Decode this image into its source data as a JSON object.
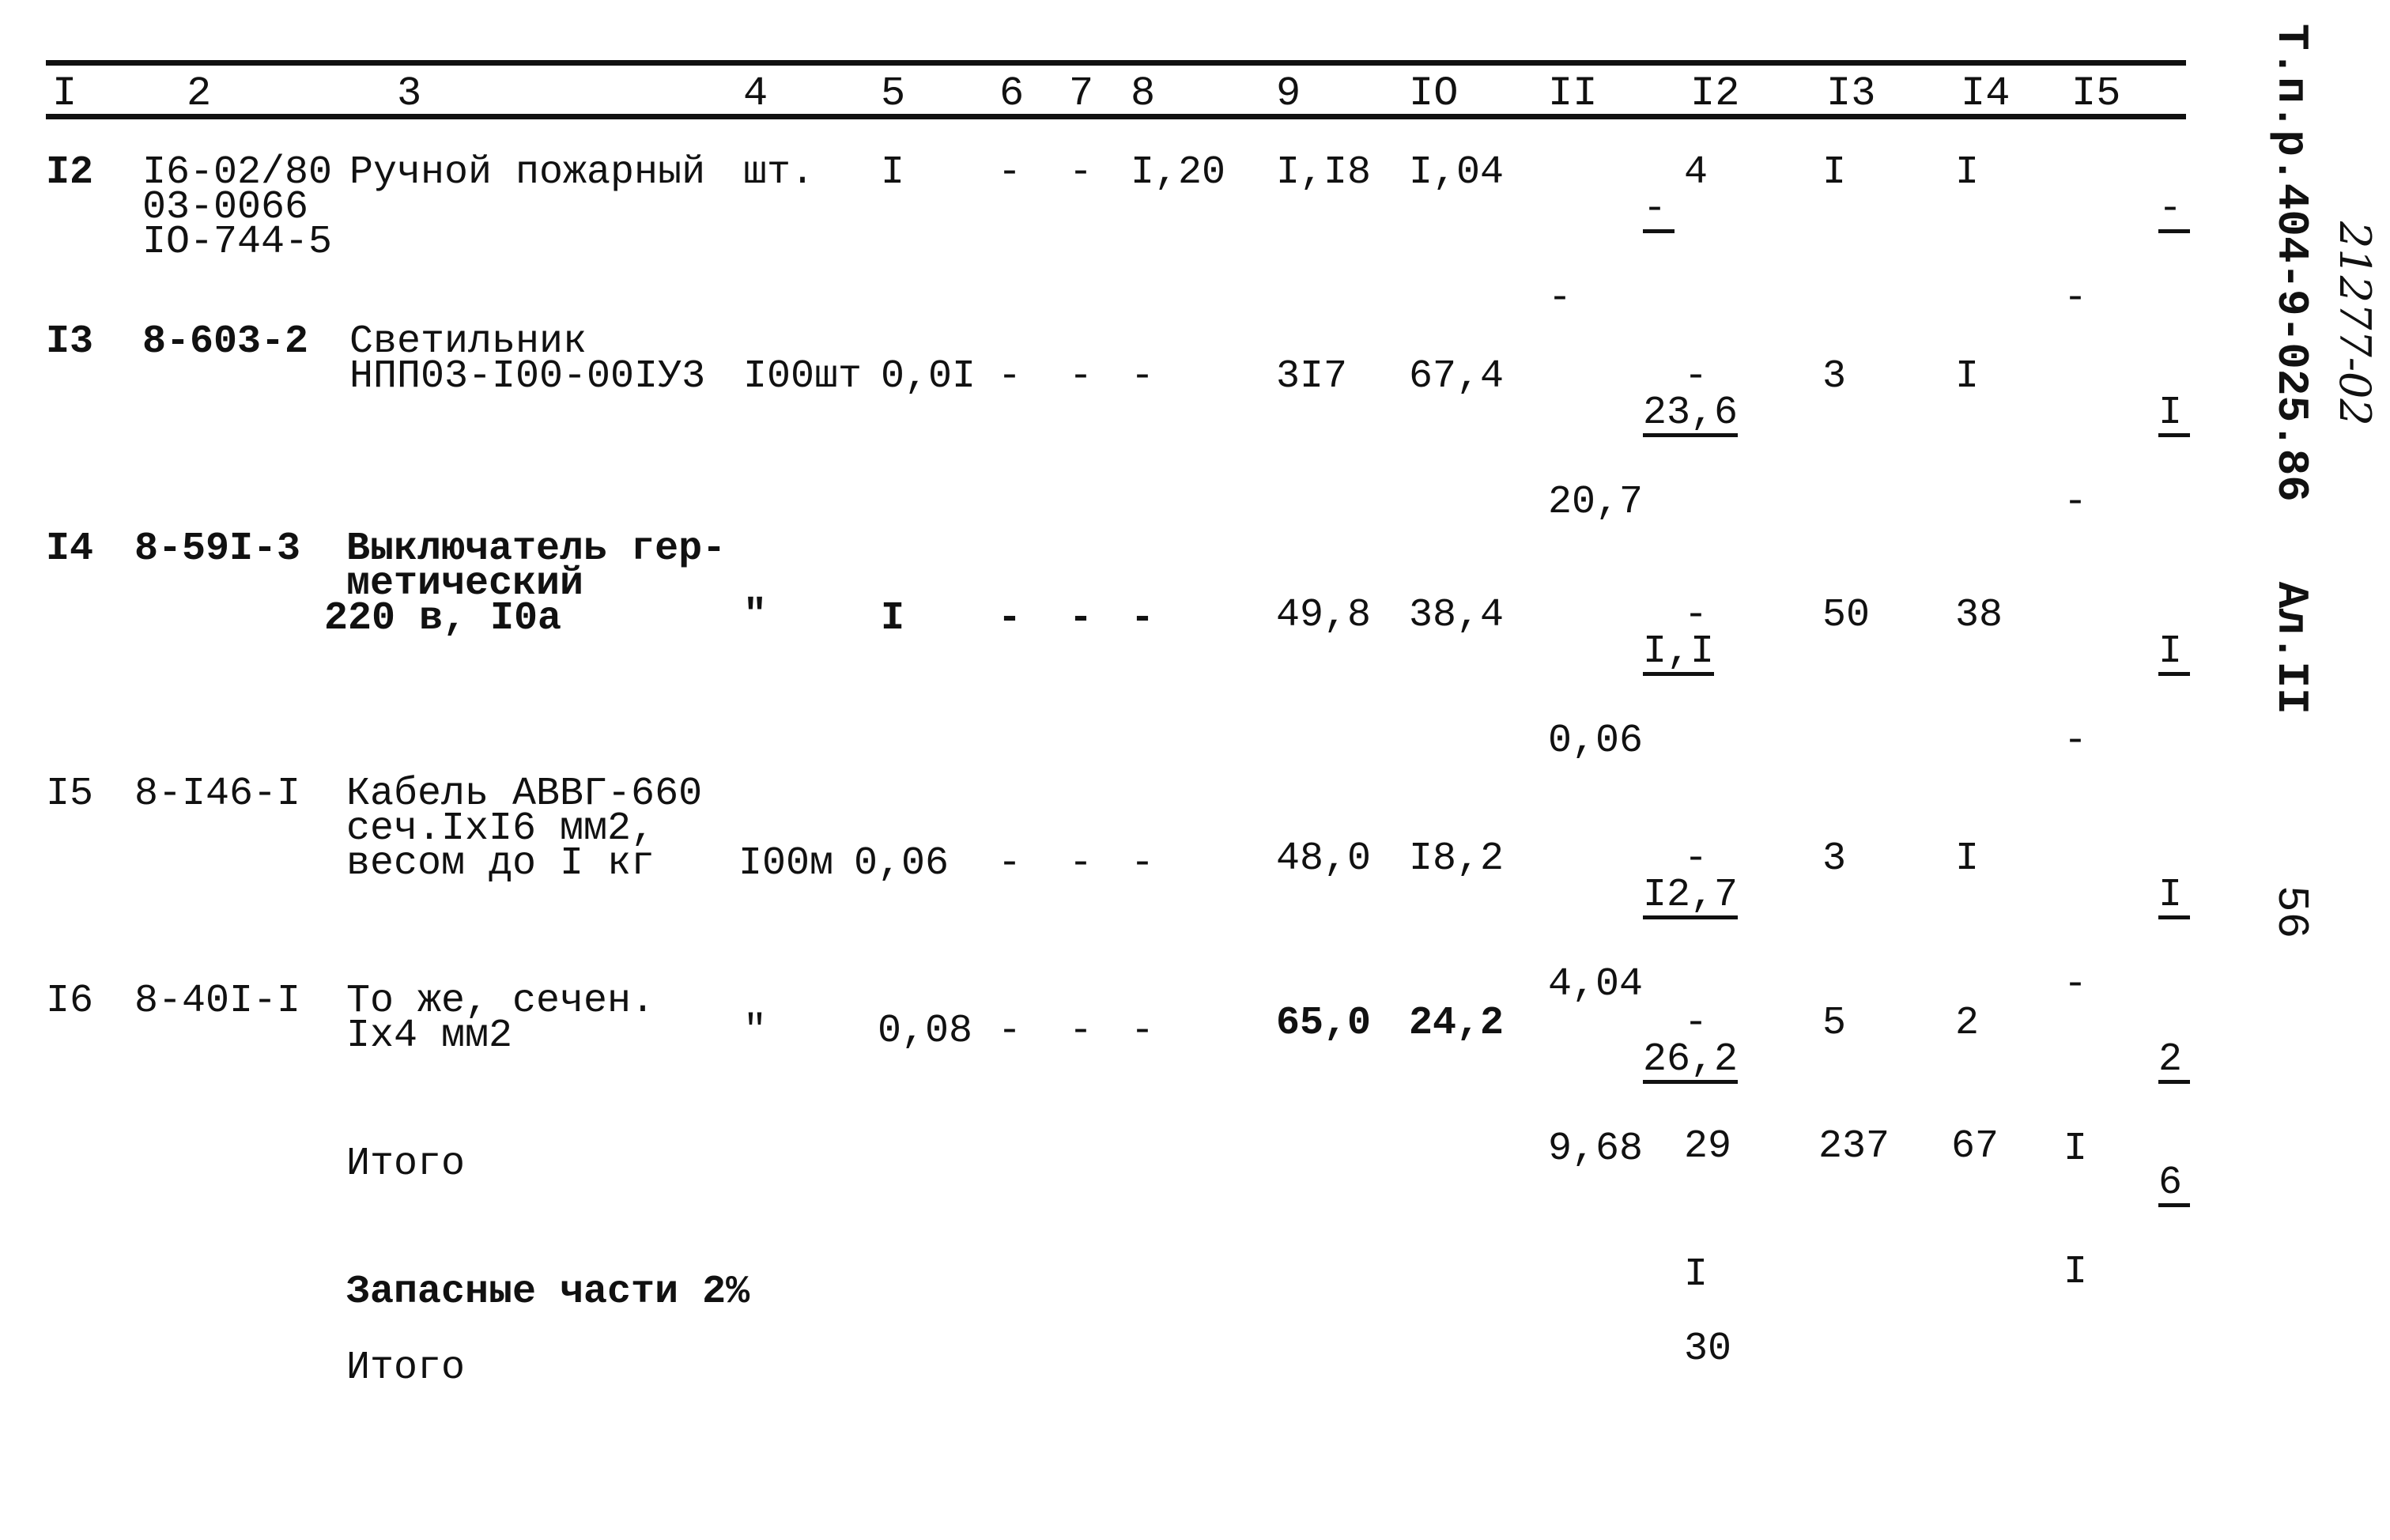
{
  "sheet": {
    "stamp": "Т.п.р.404-9-025.86   Ал.II",
    "handwritten_number": "21277-02",
    "page_number": "56"
  },
  "table": {
    "header": [
      "I",
      "2",
      "3",
      "4",
      "5",
      "6",
      "7",
      "8",
      "9",
      "IO",
      "II",
      "I2",
      "I3",
      "I4",
      "I5"
    ],
    "rows": [
      {
        "no": "I2",
        "code": [
          "I6-02/80",
          "03-0066",
          "IO-744-5"
        ],
        "name": [
          "Ручной пожарный"
        ],
        "unit": "шт.",
        "qty": "I",
        "c6": "-",
        "c7": "-",
        "c8": "I,20",
        "c9": "I,I8",
        "c10": "I,04",
        "c11": {
          "num": "-",
          "den": "-"
        },
        "c12": "4",
        "c13": "I",
        "c14": "I",
        "c15": {
          "num": "-",
          "den": "-"
        }
      },
      {
        "no": "I3",
        "code": [
          "8-603-2"
        ],
        "name": [
          "Светильник",
          "НПП03-I00-00IУ3"
        ],
        "unit": "I00шт",
        "qty": "0,0I",
        "c6": "-",
        "c7": "-",
        "c8": "-",
        "c9": "3I7",
        "c10": "67,4",
        "c11": {
          "num": "23,6",
          "den": "20,7"
        },
        "c12": "-",
        "c13": "3",
        "c14": "I",
        "c15": {
          "num": "I",
          "den": "-"
        }
      },
      {
        "no": "I4",
        "code": [
          "8-59I-3"
        ],
        "name": [
          "Выключатель гер-",
          "метический",
          "220 в, I0а"
        ],
        "unit": "\"",
        "qty": "I",
        "c6": "-",
        "c7": "-",
        "c8": "-",
        "c9": "49,8",
        "c10": "38,4",
        "c11": {
          "num": "I,I",
          "den": "0,06"
        },
        "c12": "-",
        "c13": "50",
        "c14": "38",
        "c15": {
          "num": "I",
          "den": "-"
        }
      },
      {
        "no": "I5",
        "code": [
          "8-I46-I"
        ],
        "name": [
          "Кабель АВВГ-660",
          "сеч.IxI6 мм2,",
          "весом до I кг"
        ],
        "unit": "I00м",
        "qty": "0,06",
        "c6": "-",
        "c7": "-",
        "c8": "-",
        "c9": "48,0",
        "c10": "I8,2",
        "c11": {
          "num": "I2,7",
          "den": "4,04"
        },
        "c12": "-",
        "c13": "3",
        "c14": "I",
        "c15": {
          "num": "I",
          "den": "-"
        }
      },
      {
        "no": "I6",
        "code": [
          "8-40I-I"
        ],
        "name": [
          "То же, сечен.",
          "Ix4 мм2"
        ],
        "unit": "\"",
        "qty": "0,08",
        "c6": "-",
        "c7": "-",
        "c8": "-",
        "c9": "65,0",
        "c10": "24,2",
        "c11": {
          "num": "26,2",
          "den": "9,68"
        },
        "c12": "-",
        "c13": "5",
        "c14": "2",
        "c15": {
          "num": "2",
          "den": "I"
        }
      }
    ],
    "totals": [
      {
        "label": "Итого",
        "c12": "29",
        "c13": "237",
        "c14": "67",
        "c15": {
          "num": "6",
          "den": "I"
        }
      },
      {
        "label": "Запасные части 2%",
        "c12": "I"
      },
      {
        "label": "Итого",
        "c12": "30"
      }
    ]
  }
}
